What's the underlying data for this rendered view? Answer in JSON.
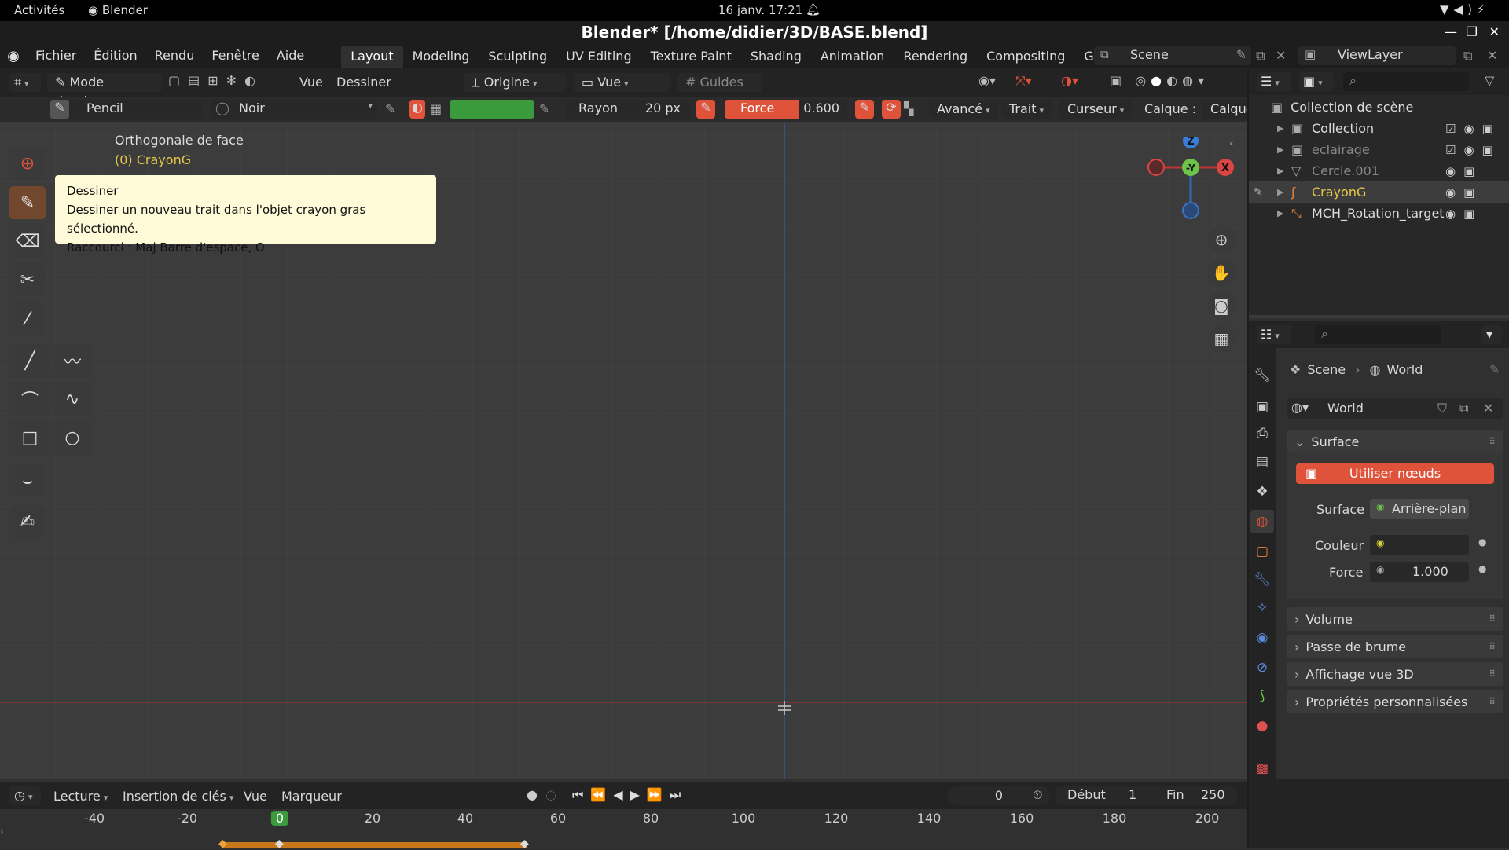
{
  "gnome": {
    "activities": "Activités",
    "app": "Blender",
    "clock": "16 janv.  17:21"
  },
  "window": {
    "title": "Blender* [/home/didier/3D/BASE.blend]"
  },
  "menu": {
    "items": [
      "Fichier",
      "Édition",
      "Rendu",
      "Fenêtre",
      "Aide"
    ]
  },
  "workspaces": [
    "Layout",
    "Modeling",
    "Sculpting",
    "UV Editing",
    "Texture Paint",
    "Shading",
    "Animation",
    "Rendering",
    "Compositing",
    "Geometry N"
  ],
  "scene": {
    "name": "Scene",
    "viewlayer": "ViewLayer"
  },
  "header": {
    "mode": "Mode dessin",
    "vue": "Vue",
    "dessiner": "Dessiner",
    "origine": "Origine",
    "view": "Vue",
    "guides": "Guides"
  },
  "toolsettings": {
    "brush": "Pencil",
    "material": "Noir",
    "rayon_label": "Rayon",
    "rayon_value": "20 px",
    "force_label": "Force",
    "force_value": "0.600",
    "avance": "Avancé",
    "trait": "Trait",
    "curseur": "Curseur",
    "calque_label": "Calque :",
    "calque_value": "Calque"
  },
  "viewport": {
    "view_name": "Orthogonale de face",
    "object": "(0) CrayonG",
    "gizmo_z": "Z",
    "gizmo_y": "-Y",
    "gizmo_x": "X"
  },
  "tooltip": {
    "title": "Dessiner",
    "desc": "Dessiner un nouveau trait dans l'objet crayon gras sélectionné.",
    "shortcut": "Raccourci : Maj Barre d'espace, O"
  },
  "outliner": {
    "root": "Collection de scène",
    "items": [
      {
        "name": "Collection",
        "color": "#dddddd"
      },
      {
        "name": "eclairage",
        "color": "#888888"
      },
      {
        "name": "Cercle.001",
        "color": "#888888"
      },
      {
        "name": "CrayonG",
        "color": "#e8c84a"
      },
      {
        "name": "MCH_Rotation_target",
        "color": "#dddddd"
      }
    ]
  },
  "properties": {
    "bc_scene": "Scene",
    "bc_world": "World",
    "world_name": "World",
    "surface_panel": "Surface",
    "use_nodes": "Utiliser nœuds",
    "surface_label": "Surface",
    "surface_value": "Arrière-plan",
    "couleur_label": "Couleur",
    "force_label": "Force",
    "force_value": "1.000",
    "panels": [
      "Volume",
      "Passe de brume",
      "Affichage vue 3D",
      "Propriétés personnalisées"
    ]
  },
  "timeline": {
    "lecture": "Lecture",
    "insertion": "Insertion de clés",
    "vue": "Vue",
    "marqueur": "Marqueur",
    "current": "0",
    "debut_label": "Début",
    "debut": "1",
    "fin_label": "Fin",
    "fin": "250",
    "ticks": [
      "-40",
      "-20",
      "0",
      "20",
      "40",
      "60",
      "80",
      "100",
      "120",
      "140",
      "160",
      "180",
      "200"
    ]
  },
  "colors": {
    "accent": "#e0533b",
    "active_tool": "#71482d",
    "object": "#e8c84a",
    "green": "#3b9a3b"
  }
}
